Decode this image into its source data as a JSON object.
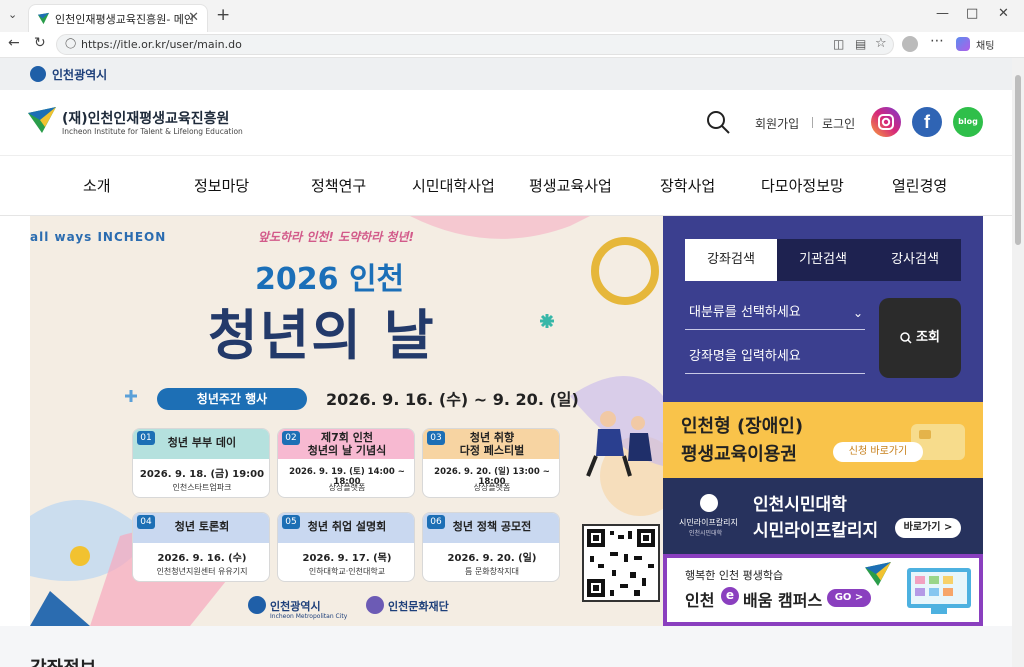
{
  "browser": {
    "tab_title": "인천인재평생교육진흥원- 메인",
    "url": "https://itle.or.kr/user/main.do",
    "chat_label": "채팅"
  },
  "page": {
    "city_name": "인천광역시",
    "logo": {
      "name": "(재)인천인재평생교육진흥원",
      "english": "Incheon Institute for Talent & Lifelong Education"
    },
    "header_links": {
      "signup": "회원가입",
      "login": "로그인"
    },
    "social": [
      {
        "name": "instagram",
        "color": "#d6287a"
      },
      {
        "name": "facebook",
        "color": "#1877f2"
      },
      {
        "name": "blog",
        "color": "#2fbf4a",
        "label": "blog"
      }
    ],
    "gnb": [
      "소개",
      "정보마당",
      "정책연구",
      "시민대학사업",
      "평생교육사업",
      "장학사업",
      "다모아정보망",
      "열린경영"
    ],
    "banner": {
      "brand": "all ways INCHEON",
      "slogan": "앞도하라 인천! 도약하라 청년!",
      "year": "2026 인천",
      "title": "청년의 날",
      "week_label": "청년주간 행사",
      "period": "2026. 9. 16. (수) ~ 9. 20. (일)",
      "events": [
        {
          "num": "01",
          "title": "청년 부부 데이",
          "date": "2026. 9. 18. (금) 19:00",
          "place": "인천스타트업파크",
          "color": "#b5e1de"
        },
        {
          "num": "02",
          "title": "제7회 인천\n청년의 날 기념식",
          "date": "2026. 9. 19. (토) 14:00 ~ 18:00",
          "place": "상상플랫폼",
          "color": "#f7b9d1"
        },
        {
          "num": "03",
          "title": "청년 취향\n다정 페스티벌",
          "date": "2026. 9. 20. (일) 13:00 ~ 18:00",
          "place": "상상플랫폼",
          "color": "#f7d4a2"
        },
        {
          "num": "04",
          "title": "청년 토론회",
          "date": "2026. 9. 16. (수)",
          "place": "인천청년지원센터 유유기지",
          "color": "#c9d8f0"
        },
        {
          "num": "05",
          "title": "청년 취업 설명회",
          "date": "2026. 9. 17. (목)",
          "place": "인하대학교·인천대학교",
          "color": "#c9d8f0"
        },
        {
          "num": "06",
          "title": "청년 정책 공모전",
          "date": "2026. 9. 20. (일)",
          "place": "틈 문화창작지대",
          "color": "#c9d8f0"
        }
      ],
      "footer_org1": "인천광역시",
      "footer_org1_sub": "Incheon Metropolitan City",
      "footer_org2": "인천문화재단"
    },
    "search": {
      "tabs": [
        "강좌검색",
        "기관검색",
        "강사검색"
      ],
      "category_placeholder": "대분류를 선택하세요",
      "name_placeholder": "강좌명을 입력하세요",
      "button": "조회"
    },
    "promos": [
      {
        "title1": "인천형 (장애인)",
        "title2": "평생교육이용권",
        "button": "신청 바로가기"
      },
      {
        "org": "시민라이프칼리지",
        "org_sub": "인천시민대학",
        "title1": "인천시민대학",
        "title2": "시민라이프칼리지",
        "button": "바로가기 >"
      },
      {
        "title1": "행복한 인천 평생학습",
        "title2_a": "인천",
        "title2_b": "e",
        "title2_c": "배움 캠퍼스",
        "button": "GO >"
      }
    ],
    "section_title": "강좌정보"
  }
}
